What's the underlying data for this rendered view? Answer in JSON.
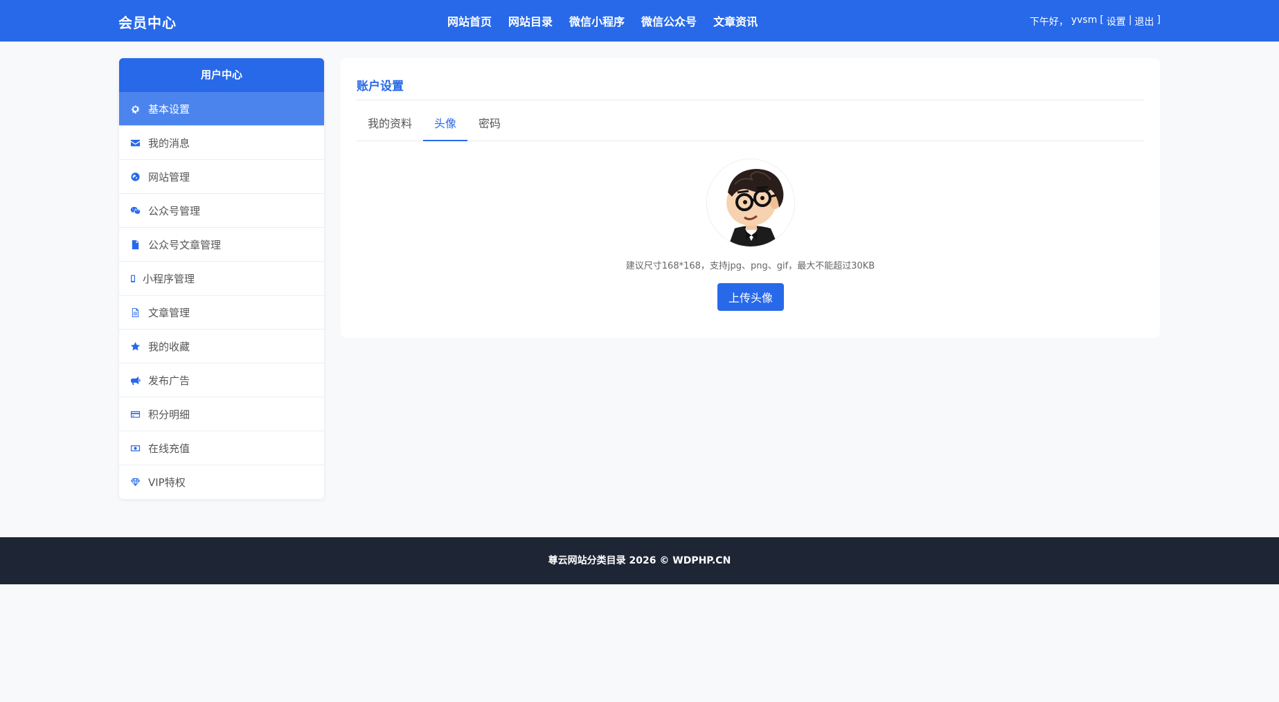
{
  "header": {
    "brand": "会员中心",
    "nav": [
      "网站首页",
      "网站目录",
      "微信小程序",
      "微信公众号",
      "文章资讯"
    ],
    "greeting": "下午好，",
    "username": "yvsm",
    "bracket_open": "[",
    "settings_label": "设置",
    "separator": "|",
    "logout_label": "退出",
    "bracket_close": "]"
  },
  "sidebar": {
    "title": "用户中心",
    "items": [
      {
        "label": "基本设置",
        "icon": "gear-icon"
      },
      {
        "label": "我的消息",
        "icon": "envelope-icon"
      },
      {
        "label": "网站管理",
        "icon": "globe-icon"
      },
      {
        "label": "公众号管理",
        "icon": "wechat-icon"
      },
      {
        "label": "公众号文章管理",
        "icon": "document-icon"
      },
      {
        "label": "小程序管理",
        "icon": "mobile-icon"
      },
      {
        "label": "文章管理",
        "icon": "file-text-icon"
      },
      {
        "label": "我的收藏",
        "icon": "star-icon"
      },
      {
        "label": "发布广告",
        "icon": "megaphone-icon"
      },
      {
        "label": "积分明细",
        "icon": "credit-card-icon"
      },
      {
        "label": "在线充值",
        "icon": "money-icon"
      },
      {
        "label": "VIP特权",
        "icon": "diamond-icon"
      }
    ]
  },
  "main": {
    "title": "账户设置",
    "tabs": [
      "我的资料",
      "头像",
      "密码"
    ],
    "hint": "建议尺寸168*168，支持jpg、png、gif，最大不能超过30KB",
    "upload_label": "上传头像"
  },
  "footer": {
    "text": "尊云网站分类目录 2026 © WDPHP.CN"
  },
  "colors": {
    "primary": "#2769e9",
    "active_item": "#4c84ee",
    "footer_bg": "#1e2635",
    "page_bg": "#f8f9fb"
  }
}
